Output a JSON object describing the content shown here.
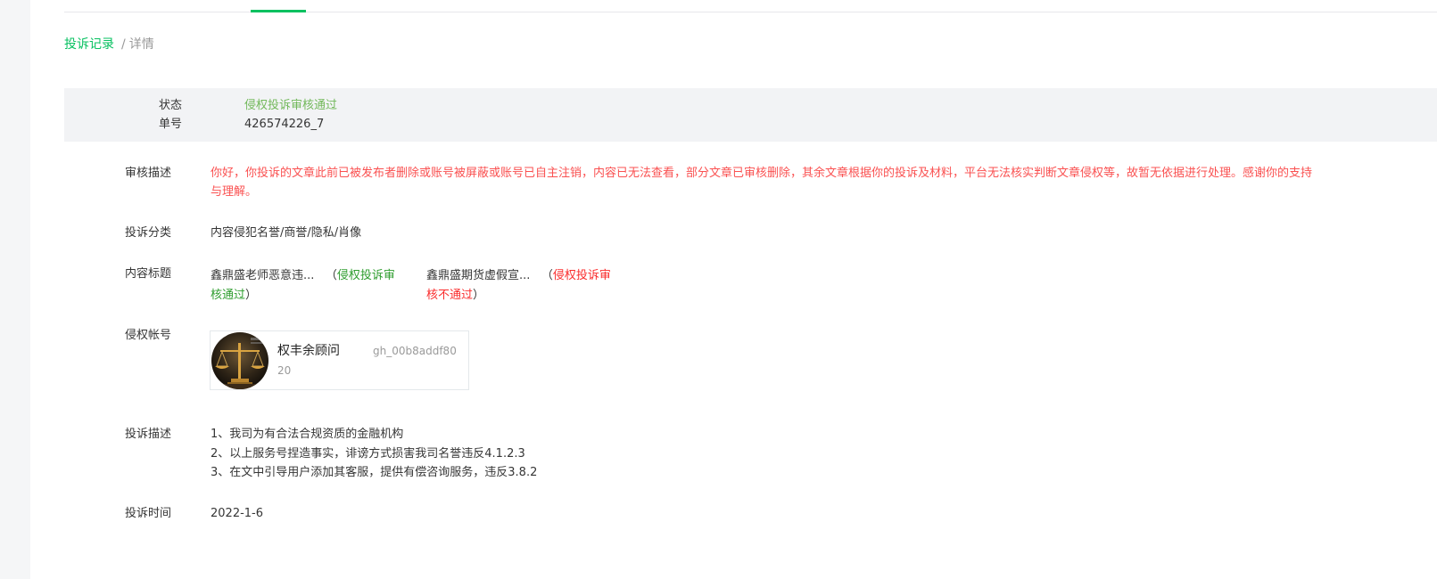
{
  "breadcrumb": {
    "link": "投诉记录",
    "separator": "/",
    "current": "详情"
  },
  "status_section": {
    "status_label": "状态",
    "status_value": "侵权投诉审核通过",
    "number_label": "单号",
    "number_value": "426574226_7"
  },
  "review": {
    "label": "审核描述",
    "text": "你好，你投诉的文章此前已被发布者删除或账号被屏蔽或账号已自主注销，内容已无法查看，部分文章已审核删除，其余文章根据你的投诉及材料，平台无法核实判断文章侵权等，故暂无依据进行处理。感谢你的支持与理解。"
  },
  "category": {
    "label": "投诉分类",
    "value": "内容侵犯名誉/商誉/隐私/肖像"
  },
  "content_titles": {
    "label": "内容标题",
    "items": [
      {
        "title": "鑫鼎盛老师恶意违...",
        "open_paren": "（",
        "status": "侵权投诉审核通过",
        "close_paren": "）"
      },
      {
        "title": "鑫鼎盛期货虚假宣...",
        "open_paren": "（",
        "status": "侵权投诉审核不通过",
        "close_paren": "）"
      }
    ]
  },
  "infringing_account": {
    "label": "侵权帐号",
    "name": "权丰余顾问",
    "id": "gh_00b8addf80",
    "id_tail": "20"
  },
  "complaint": {
    "label": "投诉描述",
    "lines": [
      "1、我司为有合法合规资质的金融机构",
      "2、以上服务号捏造事实，诽谤方式损害我司名誉违反4.1.2.3",
      "3、在文中引导用户添加其客服，提供有偿咨询服务，违反3.8.2"
    ]
  },
  "time": {
    "label": "投诉时间",
    "value": "2022-1-6"
  },
  "colors": {
    "accent_green": "#07c160",
    "status_pass": "#72b85a",
    "alert_red": "#fa5151",
    "fail_red": "#fa2c2c",
    "label_gray": "#9a9a9a"
  }
}
